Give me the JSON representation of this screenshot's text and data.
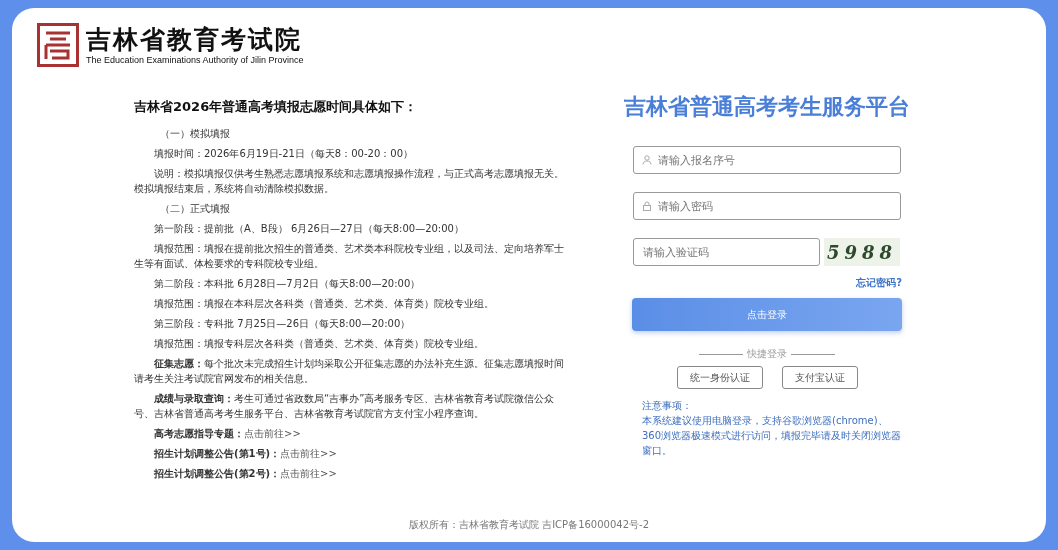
{
  "logo": {
    "title": "吉林省教育考试院",
    "subtitle": "The Education Examinations Authority of Jilin Province"
  },
  "notice": {
    "title": "吉林省2026年普通高考填报志愿时间具体如下：",
    "items": [
      {
        "kind": "heading",
        "text": "（一）模拟填报"
      },
      {
        "kind": "para",
        "text": "填报时间：2026年6月19日-21日（每天8：00-20：00）"
      },
      {
        "kind": "para",
        "text": "说明：模拟填报仅供考生熟悉志愿填报系统和志愿填报操作流程，与正式高考志愿填报无关。模拟填报结束后，系统将自动清除模拟数据。"
      },
      {
        "kind": "heading",
        "text": "（二）正式填报"
      },
      {
        "kind": "para",
        "text": "第一阶段：提前批（A、B段）    6月26日—27日（每天8:00—20:00）"
      },
      {
        "kind": "para",
        "text": "填报范围：填报在提前批次招生的普通类、艺术类本科院校专业组，以及司法、定向培养军士生等有面试、体检要求的专科院校专业组。"
      },
      {
        "kind": "para",
        "text": "第二阶段：本科批    6月28日—7月2日（每天8:00—20:00）"
      },
      {
        "kind": "para",
        "text": "填报范围：填报在本科层次各科类（普通类、艺术类、体育类）院校专业组。"
      },
      {
        "kind": "para",
        "text": "第三阶段：专科批    7月25日—26日（每天8:00—20:00）"
      },
      {
        "kind": "para",
        "text": "填报范围：填报专科层次各科类（普通类、艺术类、体育类）院校专业组。"
      },
      {
        "kind": "para",
        "text": "**征集志愿：**每个批次未完成招生计划均采取公开征集志愿的办法补充生源。征集志愿填报时间请考生关注考试院官网发布的相关信息。"
      },
      {
        "kind": "para",
        "text": "**成绩与录取查询：**考生可通过省政数局“吉事办”高考服务专区、吉林省教育考试院微信公众号、吉林省普通高考考生服务平台、吉林省教育考试院官方支付宝小程序查询。"
      },
      {
        "kind": "link",
        "lead": "高考志愿指导专题：",
        "link": "点击前往>>"
      },
      {
        "kind": "link",
        "lead": "招生计划调整公告(第1号)：",
        "link": "点击前往>>"
      },
      {
        "kind": "link",
        "lead": "招生计划调整公告(第2号)：",
        "link": "点击前往>>"
      }
    ]
  },
  "login": {
    "title": "吉林省普通高考考生服务平台",
    "fields": [
      {
        "kind": "user",
        "placeholder": "请输入报名序号"
      },
      {
        "kind": "lock",
        "placeholder": "请输入密码"
      }
    ],
    "captcha_field": {
      "placeholder": "请输入验证码"
    },
    "captcha": "5988",
    "forgot": "忘记密码?",
    "submit": "点击登录",
    "quick_label": "快捷登录",
    "quick_buttons": [
      "统一身份认证",
      "支付宝认证"
    ],
    "notes_title": "注意事项：",
    "notes": "本系统建议使用电脑登录，支持谷歌浏览器(chrome)、360浏览器极速模式进行访问，填报完毕请及时关闭浏览器窗口。"
  },
  "footer": "版权所有：吉林省教育考试院 吉ICP备16000042号-2"
}
